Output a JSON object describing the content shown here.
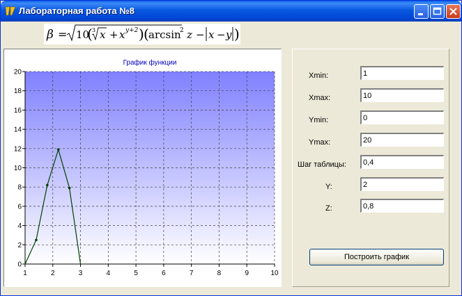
{
  "window": {
    "title": "Лабораторная работа №8"
  },
  "formula": {
    "beta": "β",
    "eq": "=",
    "ten": "10",
    "cube_index": "3",
    "x1": "x",
    "plus": "+",
    "x2": "x",
    "exponent": "y+2",
    "arcsin": "arcsin",
    "sq": "2",
    "z": "z",
    "minus1": "−",
    "x3": "x",
    "minus2": "−",
    "y": "y"
  },
  "form": {
    "xmin_label": "Xmin:",
    "xmin_value": "1",
    "xmax_label": "Xmax:",
    "xmax_value": "10",
    "ymin_label": "Ymin:",
    "ymin_value": "0",
    "ymax_label": "Ymax:",
    "ymax_value": "20",
    "step_label": "Шаг таблицы:",
    "step_value": "0,4",
    "y_label": "Y:",
    "y_value": "2",
    "z_label": "Z:",
    "z_value": "0,8",
    "build_button": "Построить график"
  },
  "colors": {
    "plot_top": "#8080ff",
    "plot_bottom": "#ffffff",
    "series": "#004000",
    "title": "#0000c0"
  },
  "chart_data": {
    "type": "line",
    "title": "График функции",
    "xlim": [
      1,
      10
    ],
    "ylim": [
      0,
      20
    ],
    "x_ticks": [
      "1",
      "2",
      "3",
      "4",
      "5",
      "6",
      "7",
      "8",
      "9",
      "10"
    ],
    "y_ticks": [
      "0",
      "2",
      "4",
      "6",
      "8",
      "10",
      "12",
      "14",
      "16",
      "18",
      "20"
    ],
    "grid": true,
    "series": [
      {
        "x": [
          1.0,
          1.4,
          1.8,
          2.2,
          2.6,
          3.0
        ],
        "y": [
          0,
          2.5,
          8.2,
          11.9,
          7.9,
          0
        ]
      }
    ]
  }
}
